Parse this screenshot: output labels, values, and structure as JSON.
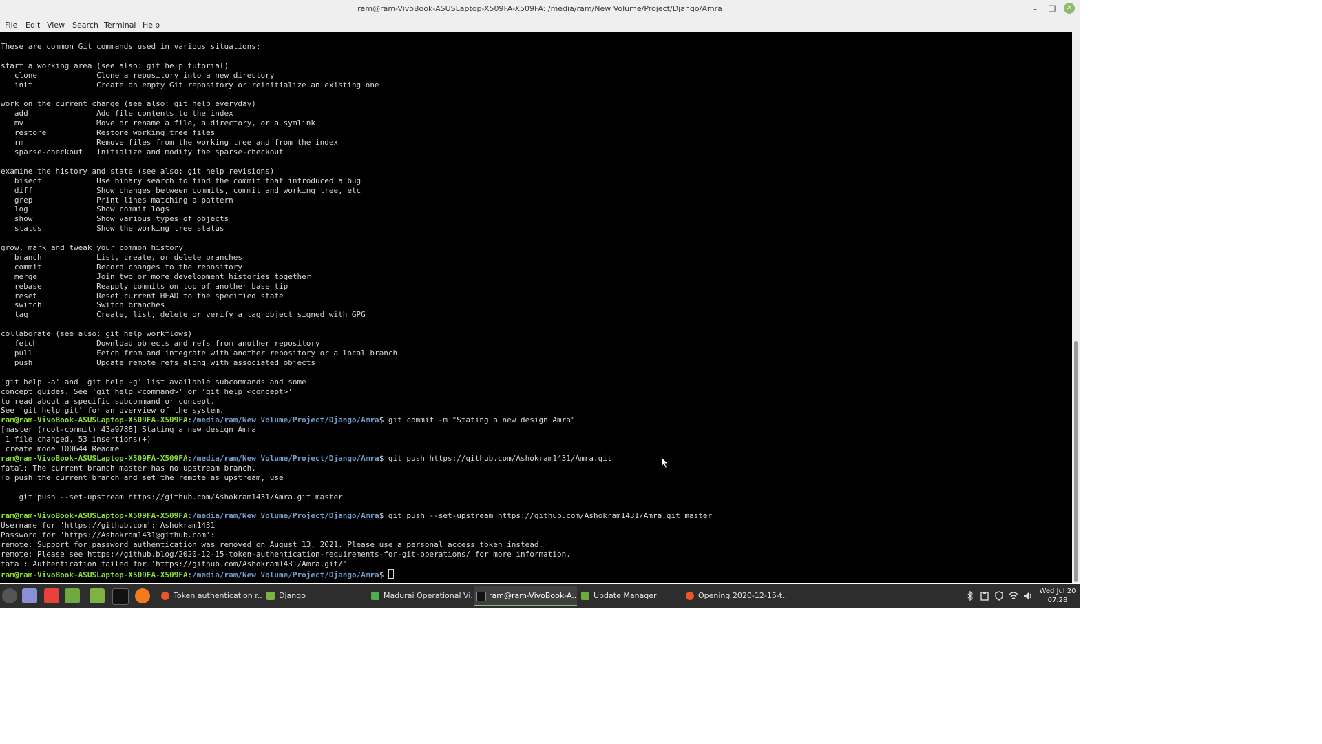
{
  "window": {
    "title": "ram@ram-VivoBook-ASUSLaptop-X509FA-X509FA: /media/ram/New Volume/Project/Django/Amra",
    "minimize_icon": "minimize-icon",
    "maximize_icon": "maximize-icon",
    "close_icon": "close-icon"
  },
  "menu": [
    "File",
    "Edit",
    "View",
    "Search",
    "Terminal",
    "Help"
  ],
  "prompt": {
    "user": "ram@ram-VivoBook-ASUSLaptop-X509FA-X509FA",
    "path": "/media/ram/New Volume/Project/Django/Amra"
  },
  "terminal": {
    "l01": "These are common Git commands used in various situations:",
    "l02": "",
    "l03": "start a working area (see also: git help tutorial)",
    "l04": "   clone             Clone a repository into a new directory",
    "l05": "   init              Create an empty Git repository or reinitialize an existing one",
    "l06": "",
    "l07": "work on the current change (see also: git help everyday)",
    "l08": "   add               Add file contents to the index",
    "l09": "   mv                Move or rename a file, a directory, or a symlink",
    "l10": "   restore           Restore working tree files",
    "l11": "   rm                Remove files from the working tree and from the index",
    "l12": "   sparse-checkout   Initialize and modify the sparse-checkout",
    "l13": "",
    "l14": "examine the history and state (see also: git help revisions)",
    "l15": "   bisect            Use binary search to find the commit that introduced a bug",
    "l16": "   diff              Show changes between commits, commit and working tree, etc",
    "l17": "   grep              Print lines matching a pattern",
    "l18": "   log               Show commit logs",
    "l19": "   show              Show various types of objects",
    "l20": "   status            Show the working tree status",
    "l21": "",
    "l22": "grow, mark and tweak your common history",
    "l23": "   branch            List, create, or delete branches",
    "l24": "   commit            Record changes to the repository",
    "l25": "   merge             Join two or more development histories together",
    "l26": "   rebase            Reapply commits on top of another base tip",
    "l27": "   reset             Reset current HEAD to the specified state",
    "l28": "   switch            Switch branches",
    "l29": "   tag               Create, list, delete or verify a tag object signed with GPG",
    "l30": "",
    "l31": "collaborate (see also: git help workflows)",
    "l32": "   fetch             Download objects and refs from another repository",
    "l33": "   pull              Fetch from and integrate with another repository or a local branch",
    "l34": "   push              Update remote refs along with associated objects",
    "l35": "",
    "l36": "'git help -a' and 'git help -g' list available subcommands and some",
    "l37": "concept guides. See 'git help <command>' or 'git help <concept>'",
    "l38": "to read about a specific subcommand or concept.",
    "l39": "See 'git help git' for an overview of the system.",
    "cmd1": "$ git commit -m \"Stating a new design Amra\"",
    "l41": "[master (root-commit) 43a9788] Stating a new design Amra",
    "l42": " 1 file changed, 53 insertions(+)",
    "l43": " create mode 100644 Readme",
    "cmd2": "$ git push https://github.com/Ashokram1431/Amra.git",
    "l45": "fatal: The current branch master has no upstream branch.",
    "l46": "To push the current branch and set the remote as upstream, use",
    "l47": "",
    "l48": "    git push --set-upstream https://github.com/Ashokram1431/Amra.git master",
    "l49": "",
    "cmd3": "$ git push --set-upstream https://github.com/Ashokram1431/Amra.git master",
    "l51": "Username for 'https://github.com': Ashokram1431",
    "l52": "Password for 'https://Ashokram1431@github.com':",
    "l53": "remote: Support for password authentication was removed on August 13, 2021. Please use a personal access token instead.",
    "l54": "remote: Please see https://github.blog/2020-12-15-token-authentication-requirements-for-git-operations/ for more information.",
    "l55": "fatal: Authentication failed for 'https://github.com/Ashokram1431/Amra.git/'",
    "cmd4": "$ "
  },
  "taskbar": {
    "launchers": [
      "menu-icon",
      "notes-icon",
      "git-gui-icon",
      "files-icon",
      "folder-icon",
      "terminal-icon",
      "firefox-icon"
    ],
    "tasks": [
      {
        "label": "Token authentication r...",
        "icon": "firefox-icon"
      },
      {
        "label": "Django",
        "icon": "folder-icon"
      },
      {
        "label": "Madurai Operational Vi...",
        "icon": "spreadsheet-icon"
      },
      {
        "label": "ram@ram-VivoBook-A...",
        "icon": "terminal-icon",
        "active": true
      },
      {
        "label": "Update Manager",
        "icon": "shield-icon"
      },
      {
        "label": "Opening 2020-12-15-t...",
        "icon": "firefox-icon"
      }
    ],
    "tray": [
      "bluetooth-icon",
      "clipboard-icon",
      "shield-icon",
      "wifi-icon",
      "volume-icon"
    ],
    "clock_date": "Wed Jul 20",
    "clock_time": "07:28"
  }
}
